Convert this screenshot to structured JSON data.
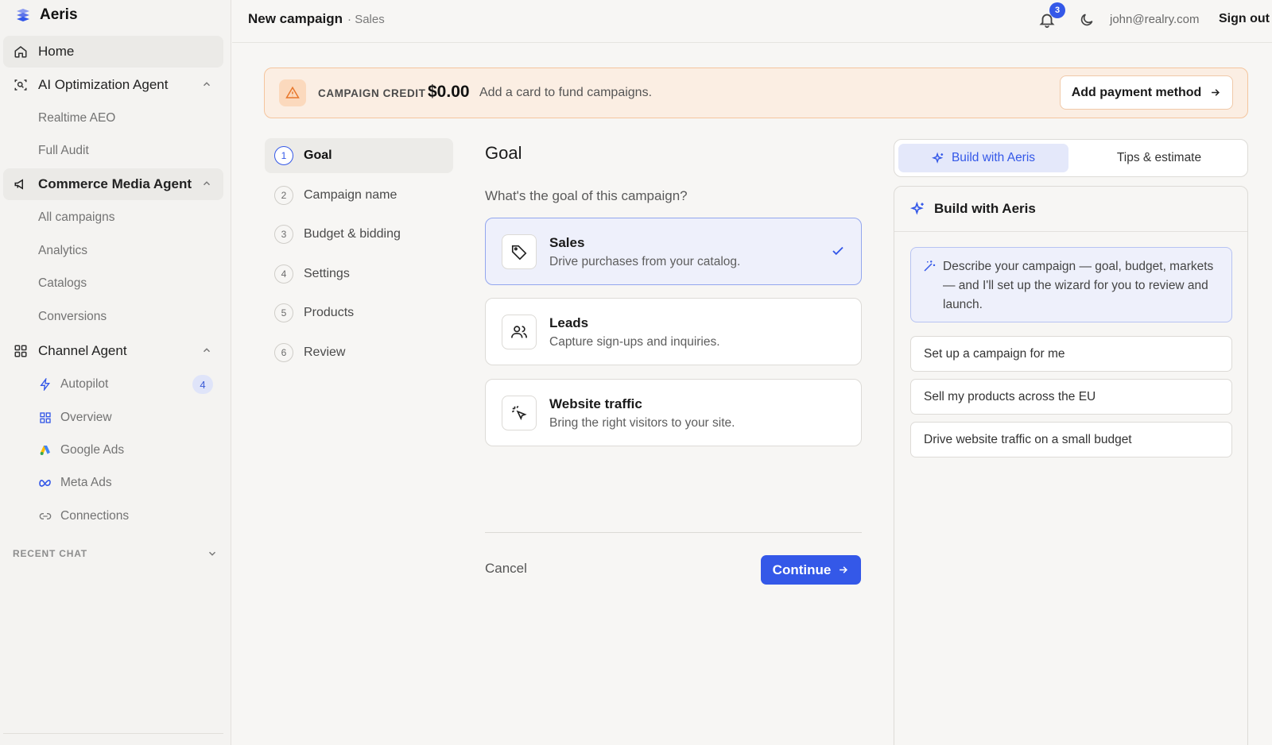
{
  "app": {
    "name": "Aeris"
  },
  "sidebar": {
    "home": "Home",
    "ai_agent": {
      "label": "AI Optimization Agent",
      "items": [
        "Realtime AEO",
        "Full Audit"
      ]
    },
    "commerce_agent": {
      "label": "Commerce Media Agent",
      "items": [
        "All campaigns",
        "Analytics",
        "Catalogs",
        "Conversions"
      ]
    },
    "channel_agent": {
      "label": "Channel Agent",
      "items": [
        {
          "label": "Autopilot",
          "icon": "bolt-icon",
          "badge": "4"
        },
        {
          "label": "Overview",
          "icon": "grid-icon"
        },
        {
          "label": "Google Ads",
          "icon": "google-ads-icon"
        },
        {
          "label": "Meta Ads",
          "icon": "meta-icon"
        },
        {
          "label": "Connections",
          "icon": "link-icon"
        }
      ]
    },
    "recent_chat": "RECENT CHAT"
  },
  "header": {
    "title": "New campaign",
    "subtitle": "· Sales",
    "notifications": "3",
    "email": "john@realry.com",
    "sign_out": "Sign out"
  },
  "banner": {
    "label": "CAMPAIGN CREDIT",
    "amount": "$0.00",
    "text": "Add a card to fund campaigns.",
    "button": "Add payment method"
  },
  "steps": [
    {
      "num": "1",
      "label": "Goal"
    },
    {
      "num": "2",
      "label": "Campaign name"
    },
    {
      "num": "3",
      "label": "Budget & bidding"
    },
    {
      "num": "4",
      "label": "Settings"
    },
    {
      "num": "5",
      "label": "Products"
    },
    {
      "num": "6",
      "label": "Review"
    }
  ],
  "goal": {
    "title": "Goal",
    "question": "What's the goal of this campaign?",
    "options": [
      {
        "title": "Sales",
        "desc": "Drive purchases from your catalog.",
        "icon": "tag-icon",
        "selected": true
      },
      {
        "title": "Leads",
        "desc": "Capture sign-ups and inquiries.",
        "icon": "users-icon",
        "selected": false
      },
      {
        "title": "Website traffic",
        "desc": "Bring the right visitors to your site.",
        "icon": "cursor-click-icon",
        "selected": false
      }
    ],
    "cancel": "Cancel",
    "continue": "Continue"
  },
  "right_panel": {
    "tabs": [
      "Build with Aeris",
      "Tips & estimate"
    ],
    "card_title": "Build with Aeris",
    "prompt": "Describe your campaign — goal, budget, markets — and I'll set up the wizard for you to review and launch.",
    "suggestions": [
      "Set up a campaign for me",
      "Sell my products across the EU",
      "Drive website traffic on a small budget"
    ]
  },
  "colors": {
    "accent": "#3458e8",
    "banner_bg": "#fbeee3",
    "banner_border": "#f4c59e",
    "warning": "#e8772b"
  }
}
